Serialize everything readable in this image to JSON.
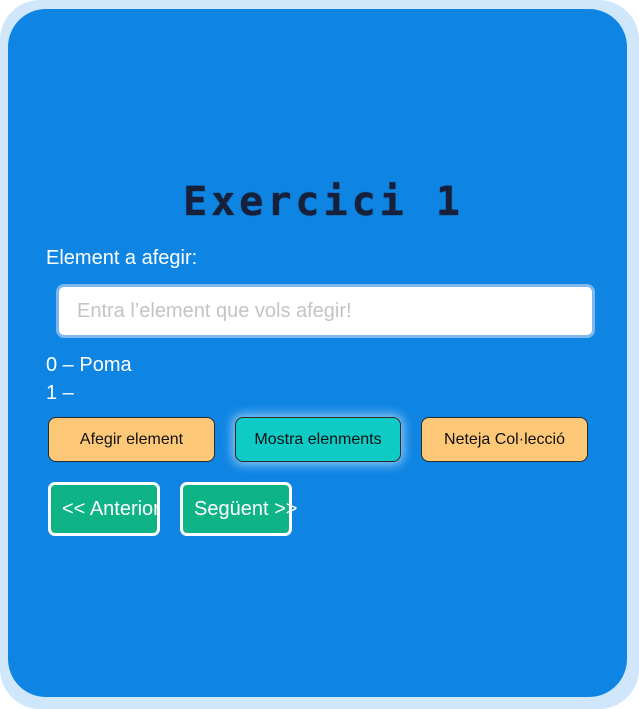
{
  "title": "Exercici 1",
  "input_section": {
    "label": "Element a afegir:",
    "placeholder": "Entra l’element que vols afegir!",
    "value": ""
  },
  "list": {
    "items": [
      "0 – Poma",
      "1 –"
    ]
  },
  "actions": {
    "add_label": "Afegir element",
    "show_label": "Mostra elenments",
    "clear_label": "Neteja Col·lecció"
  },
  "navigation": {
    "prev_label": "<< Anterior",
    "next_label": "Següent >>"
  },
  "colors": {
    "panel": "#0e85e3",
    "orange_button": "#fdc878",
    "teal_button": "#0ecbc6",
    "nav_button": "#0fb486"
  }
}
